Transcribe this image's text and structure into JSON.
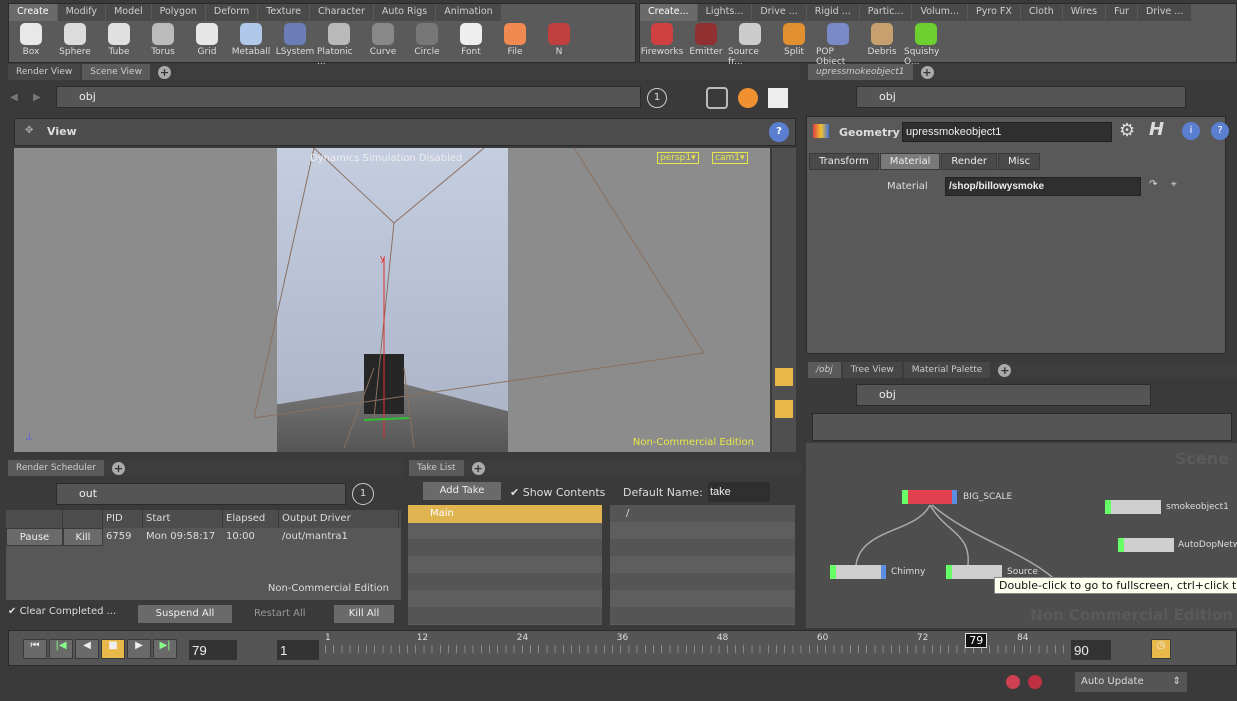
{
  "shelf_left": {
    "tabs": [
      "Create",
      "Modify",
      "Model",
      "Polygon",
      "Deform",
      "Texture",
      "Character",
      "Auto Rigs",
      "Animation"
    ],
    "tools": [
      {
        "label": "Box",
        "color": "#e8e8e8"
      },
      {
        "label": "Sphere",
        "color": "#dcdcdc"
      },
      {
        "label": "Tube",
        "color": "#e0e0e0"
      },
      {
        "label": "Torus",
        "color": "#bbbbbb"
      },
      {
        "label": "Grid",
        "color": "#e6e6e6"
      },
      {
        "label": "Metaball",
        "color": "#b0c8ea"
      },
      {
        "label": "LSystem",
        "color": "#6c7eb8"
      },
      {
        "label": "Platonic ...",
        "color": "#b9b9b9"
      },
      {
        "label": "Curve",
        "color": "#888888"
      },
      {
        "label": "Circle",
        "color": "#777777"
      },
      {
        "label": "Font",
        "color": "#eeeeee"
      },
      {
        "label": "File",
        "color": "#f08a50"
      },
      {
        "label": "N",
        "color": "#c04040"
      }
    ]
  },
  "shelf_right": {
    "tabs": [
      "Create...",
      "Lights...",
      "Drive ...",
      "Rigid ...",
      "Partic...",
      "Volum...",
      "Pyro FX",
      "Cloth",
      "Wires",
      "Fur",
      "Drive ..."
    ],
    "tools": [
      {
        "label": "Fireworks",
        "color": "#d04040"
      },
      {
        "label": "Emitter",
        "color": "#903030"
      },
      {
        "label": "Source fr...",
        "color": "#cccccc"
      },
      {
        "label": "Split",
        "color": "#e09030"
      },
      {
        "label": "POP Object",
        "color": "#7a8ac8"
      },
      {
        "label": "Debris",
        "color": "#c8a070"
      },
      {
        "label": "Squishy O...",
        "color": "#6ed030"
      }
    ]
  },
  "left_pane": {
    "tabs": [
      "Render View",
      "Scene View"
    ],
    "path": "obj",
    "snapshot": "1",
    "view_title": "View",
    "overlay": "Dynamics Simulation Disabled",
    "camera_menus": [
      "persp1",
      "cam1"
    ],
    "watermark": "Non-Commercial Edition",
    "axis_label": "y"
  },
  "params": {
    "tab": "upressmokeobject1",
    "path": "obj",
    "type_label": "Geometry",
    "node_name": "upressmokeobject1",
    "tabs": [
      "Transform",
      "Material",
      "Render",
      "Misc"
    ],
    "active_tab": "Material",
    "material_label": "Material",
    "material_value": "/shop/billowysmoke"
  },
  "network": {
    "tabs": [
      "/obj",
      "Tree View",
      "Material Palette"
    ],
    "path": "obj",
    "context_label": "Scene",
    "watermark": "Non Commercial Edition",
    "nodes": [
      {
        "name": "BIG_SCALE",
        "color": "#e04050"
      },
      {
        "name": "smokeobject1",
        "color": "#cfcfcf"
      },
      {
        "name": "AutoDopNetwork",
        "color": "#cfcfcf"
      },
      {
        "name": "Chimny",
        "color": "#cfcfcf"
      },
      {
        "name": "Source",
        "color": "#cfcfcf"
      }
    ],
    "tooltip": "Double-click to go to fullscreen, ctrl+click to"
  },
  "render_scheduler": {
    "tab": "Render Scheduler",
    "path": "out",
    "snapshot": "1",
    "columns": [
      "",
      "",
      "PID",
      "Start",
      "Elapsed",
      "Output Driver"
    ],
    "rows": [
      {
        "pause": "Pause",
        "kill": "Kill",
        "pid": "6759",
        "start": "Mon 09:58:17",
        "elapsed": "10:00",
        "driver": "/out/mantra1"
      }
    ],
    "watermark": "Non-Commercial Edition",
    "clear_completed": "Clear Completed ...",
    "clear_checked": true,
    "suspend_all": "Suspend All",
    "restart_all": "Restart All",
    "kill_all": "Kill All"
  },
  "take_list": {
    "tab": "Take List",
    "add_take": "Add Take",
    "show_contents": "Show Contents",
    "show_checked": true,
    "default_name_label": "Default Name:",
    "default_name": "take",
    "takes": [
      "Main"
    ],
    "tree_root": "/"
  },
  "timeline": {
    "current_frame": "79",
    "start_frame": "1",
    "end_frame": "90",
    "ticks": [
      "1",
      "12",
      "24",
      "36",
      "48",
      "60",
      "72",
      "84"
    ],
    "marker": "79",
    "range": [
      1,
      90
    ]
  },
  "status": {
    "update_mode": "Auto Update"
  },
  "colors": {
    "accent": "#e8b84a",
    "node_flag_green": "#66dd44",
    "overlay_yellow": "#e6e64a"
  }
}
